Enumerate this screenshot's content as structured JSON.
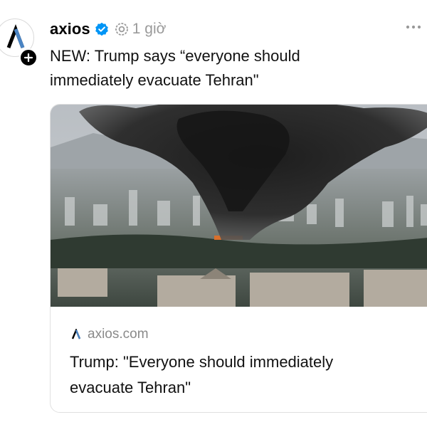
{
  "post": {
    "author": "axios",
    "verified_icon": "verified-badge-icon",
    "ai_icon": "ai-label-icon",
    "time": "1 giờ",
    "more_icon": "more-horizontal-icon",
    "text_line1": "NEW: Trump says “everyone should",
    "text_line2": "immediately evacuate Tehran\""
  },
  "avatar": {
    "logo_icon": "axios-logo-icon",
    "follow_icon": "plus-icon"
  },
  "card": {
    "image": "smoke-over-city-photo",
    "domain_icon": "axios-favicon-icon",
    "domain": "axios.com",
    "title_line1": "Trump: \"Everyone should immediately",
    "title_line2": "evacuate Tehran\""
  },
  "colors": {
    "verified_blue": "#0095f6",
    "muted_text": "#9a9a9a",
    "card_border": "#e0e0e0"
  }
}
